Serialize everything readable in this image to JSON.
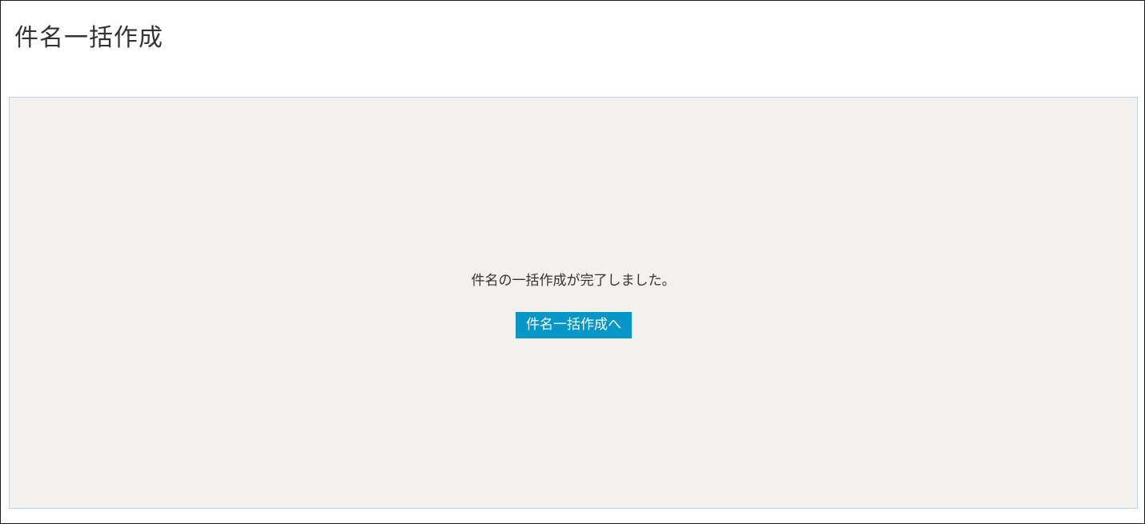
{
  "header": {
    "title": "件名一括作成"
  },
  "main": {
    "message": "件名の一括作成が完了しました。",
    "button_label": "件名一括作成へ"
  },
  "colors": {
    "button_bg": "#0697c8",
    "panel_bg": "#f2f1ed",
    "panel_border": "#b8d4e8",
    "text": "#333333"
  }
}
